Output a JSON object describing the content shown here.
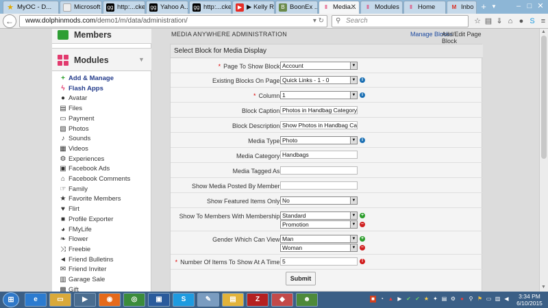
{
  "tabs": [
    {
      "label": "MyOC - D...",
      "icon": "star-icon",
      "color": "#e0a800"
    },
    {
      "label": "Microsoft Wo...",
      "icon": "blank-page-icon",
      "color": "#dddddd"
    },
    {
      "label": "http:...cker",
      "icon": "gg-icon",
      "color": "#000000"
    },
    {
      "label": "Yahoo A...",
      "icon": "gg-icon",
      "color": "#000000"
    },
    {
      "label": "http:...cker",
      "icon": "gg-icon",
      "color": "#000000"
    },
    {
      "label": "▶ Kelly R...",
      "icon": "youtube-icon",
      "color": "#e52d27"
    },
    {
      "label": "BoonEx ...",
      "icon": "boonex-icon",
      "color": "#6a8a4a"
    },
    {
      "label": "Media...",
      "icon": "dolphin-icon",
      "color": "#e23a6e"
    },
    {
      "label": "Modules",
      "icon": "dolphin-icon",
      "color": "#e23a6e"
    },
    {
      "label": "Home",
      "icon": "dolphin-icon",
      "color": "#e23a6e"
    },
    {
      "label": "Inbo",
      "icon": "gmail-icon",
      "color": "#d93025"
    }
  ],
  "url": {
    "domain": "www.dolphinmods.com",
    "path": "/demo1/m/data/administration/"
  },
  "search_placeholder": "Search",
  "sidebar": {
    "members_title": "Members",
    "modules_title": "Modules",
    "items": [
      {
        "label": "Add & Manage",
        "icon": "plus-icon",
        "glyph": "+",
        "bold": true
      },
      {
        "label": "Flash Apps",
        "icon": "lightning-icon",
        "glyph": "ϟ",
        "bold": true
      },
      {
        "label": "Avatar",
        "icon": "user-icon",
        "glyph": "●"
      },
      {
        "label": "Files",
        "icon": "files-icon",
        "glyph": "▤"
      },
      {
        "label": "Payment",
        "icon": "credit-card-icon",
        "glyph": "▭"
      },
      {
        "label": "Photos",
        "icon": "photo-icon",
        "glyph": "▧"
      },
      {
        "label": "Sounds",
        "icon": "speaker-icon",
        "glyph": "♪"
      },
      {
        "label": "Videos",
        "icon": "film-icon",
        "glyph": "▦"
      },
      {
        "label": "Experiences",
        "icon": "gears-icon",
        "glyph": "⚙"
      },
      {
        "label": "Facebook Ads",
        "icon": "facebook-ads-icon",
        "glyph": "▣"
      },
      {
        "label": "Facebook Comments",
        "icon": "home-icon",
        "glyph": "⌂"
      },
      {
        "label": "Family",
        "icon": "hand-icon",
        "glyph": "☞"
      },
      {
        "label": "Favorite Members",
        "icon": "star-icon",
        "glyph": "★"
      },
      {
        "label": "Flirt",
        "icon": "heart-icon",
        "glyph": "♥"
      },
      {
        "label": "Profile Exporter",
        "icon": "save-icon",
        "glyph": "■"
      },
      {
        "label": "FMyLife",
        "icon": "comment-icon",
        "glyph": "◕"
      },
      {
        "label": "Flower",
        "icon": "leaf-icon",
        "glyph": "❧"
      },
      {
        "label": "Freebie",
        "icon": "shuffle-icon",
        "glyph": "⤨"
      },
      {
        "label": "Friend Bulletins",
        "icon": "bullhorn-icon",
        "glyph": "◄"
      },
      {
        "label": "Friend Inviter",
        "icon": "envelope-icon",
        "glyph": "✉"
      },
      {
        "label": "Garage Sale",
        "icon": "cart-icon",
        "glyph": "▥"
      },
      {
        "label": "Gift",
        "icon": "gift-icon",
        "glyph": "▩"
      }
    ]
  },
  "admin": {
    "title": "MEDIA ANYWHERE ADMINISTRATION",
    "link_manage": "Manage Blocks",
    "link_add_edit": "Add/Edit Page Block",
    "panel_title": "Select Block for Media Display"
  },
  "form": {
    "page_to_show_block": {
      "label": "Page To Show Block:",
      "value": "Account"
    },
    "existing_blocks": {
      "label": "Existing Blocks On Page:",
      "value": "Quick Links - 1 - 0"
    },
    "column": {
      "label": "Column:",
      "value": "1"
    },
    "block_caption": {
      "label": "Block Caption:",
      "value": "Photos in Handbag Category"
    },
    "block_description": {
      "label": "Block Description:",
      "value": "Show Photos in Handbag Category"
    },
    "media_type": {
      "label": "Media Type:",
      "value": "Photo"
    },
    "media_category": {
      "label": "Media Category:",
      "value": "Handbags"
    },
    "media_tagged_as": {
      "label": "Media Tagged As:",
      "value": ""
    },
    "show_posted_by": {
      "label": "Show Media Posted By Member:",
      "value": ""
    },
    "show_featured": {
      "label": "Show Featured Items Only:",
      "value": "No"
    },
    "membership": {
      "label": "Show To Members With Membership:",
      "values": [
        "Standard",
        "Promotion"
      ]
    },
    "gender": {
      "label": "Gender Which Can View:",
      "values": [
        "Man",
        "Woman"
      ]
    },
    "num_items": {
      "label": "Number Of Items To Show At A Time:",
      "value": "5"
    },
    "submit_label": "Submit"
  },
  "taskbar": {
    "start_label": "⊞",
    "time": "3:34 PM",
    "date": "6/10/2015"
  }
}
